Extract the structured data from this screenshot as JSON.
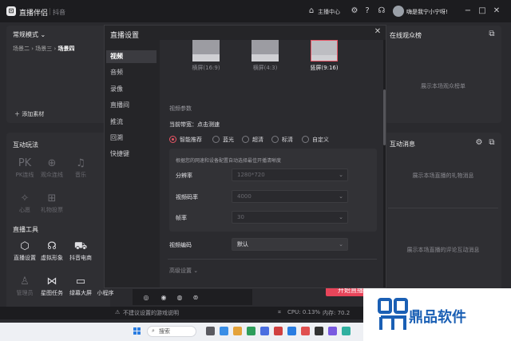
{
  "titlebar": {
    "app_name": "直播伴侣",
    "platform": "抖音",
    "host_center": "主播中心",
    "username": "嗨是我宁小宁呀!"
  },
  "scene_panel": {
    "mode": "常规模式",
    "scenes": [
      "场景二",
      "场景三",
      "场景四"
    ],
    "add_material": "添加素材"
  },
  "interact_panel": {
    "title": "互动玩法",
    "tools": [
      "PK连线",
      "观众连线",
      "音乐",
      "心愿",
      "礼物投票"
    ]
  },
  "live_tools": {
    "title": "直播工具",
    "tools": [
      "直播设置",
      "虚拟形象",
      "抖音电商",
      "管理员",
      "星图任务",
      "绿幕大屏",
      "小程序"
    ]
  },
  "right_panel": {
    "title": "在线观众榜",
    "empty": "展示本场观众榜单",
    "title2": "互动消息",
    "gift_empty": "展示本场直播的礼物消息",
    "comment_empty": "展示本场直播的评论互动消息"
  },
  "dialog": {
    "title": "直播设置",
    "nav": [
      "视频",
      "音频",
      "录像",
      "直播间",
      "推流",
      "回溯",
      "快捷键"
    ],
    "layouts": [
      "横屏(16:9)",
      "横屏(4:3)",
      "竖屏(9:16)"
    ],
    "video_params": "视频参数",
    "bandwidth": "当前带宽：点击测速",
    "quality_options": [
      "智能推荐",
      "蓝光",
      "超清",
      "标清",
      "自定义"
    ],
    "param_hint": "根据您的网速和设备配置自动选择最佳开播清晰度",
    "resolution_label": "分辨率",
    "resolution_value": "1280*720",
    "bitrate_label": "视频码率",
    "bitrate_value": "4000",
    "fps_label": "帧率",
    "fps_value": "30",
    "encoder_label": "视频编码",
    "encoder_value": "默认",
    "advanced": "高级设置"
  },
  "start_button": "开始直播",
  "status": {
    "warning": "不建议设置的游戏说明",
    "cpu": "CPU: 0.13%",
    "memory": "内存: 70.2"
  },
  "taskbar": {
    "search": "搜索"
  },
  "watermark": "鼎品软件",
  "colors": {
    "accent": "#e85565",
    "background": "#2a2a2e",
    "dialog": "#252528"
  }
}
